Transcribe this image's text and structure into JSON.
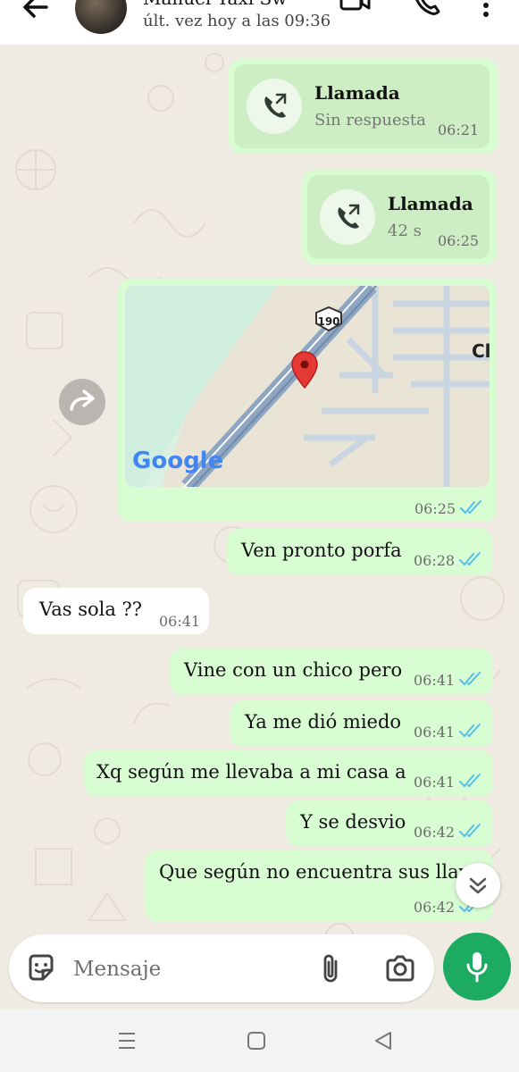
{
  "header": {
    "contact_name": "Manuel Taxi Sw",
    "last_seen": "últ. vez hoy a las 09:36",
    "icons": [
      "back-arrow-icon",
      "avatar",
      "video-call-icon",
      "voice-call-icon",
      "more-options-icon"
    ]
  },
  "messages": {
    "call1": {
      "title": "Llamada",
      "subtitle": "Sin respuesta",
      "time": "06:21"
    },
    "call2": {
      "title": "Llamada",
      "subtitle": "42 s",
      "time": "06:25"
    },
    "location": {
      "time": "06:25",
      "map_labels": {
        "route_shield": "190",
        "google": "Google",
        "place_partial": "Cl"
      }
    },
    "m1": {
      "text": "Ven pronto porfa",
      "time": "06:28"
    },
    "m2": {
      "text": "Vas sola ??",
      "time": "06:41"
    },
    "m3": {
      "text": "Vine con un chico pero",
      "time": "06:41"
    },
    "m4": {
      "text": "Ya me dió miedo",
      "time": "06:41"
    },
    "m5": {
      "text": "Xq según me llevaba a mi casa a",
      "time": "06:41"
    },
    "m6": {
      "text": "Y se desvio",
      "time": "06:42"
    },
    "m7": {
      "text": "Que según no encuentra sus llave",
      "time": "06:42"
    }
  },
  "composer": {
    "placeholder": "Mensaje",
    "icons": [
      "sticker-icon",
      "attach-icon",
      "camera-icon",
      "mic-icon"
    ]
  },
  "colors": {
    "outgoing_bubble": "#d9fdd3",
    "incoming_bubble": "#ffffff",
    "read_ticks": "#53bdeb",
    "mic_button": "#1daa61",
    "wallpaper": "#efeae2"
  }
}
